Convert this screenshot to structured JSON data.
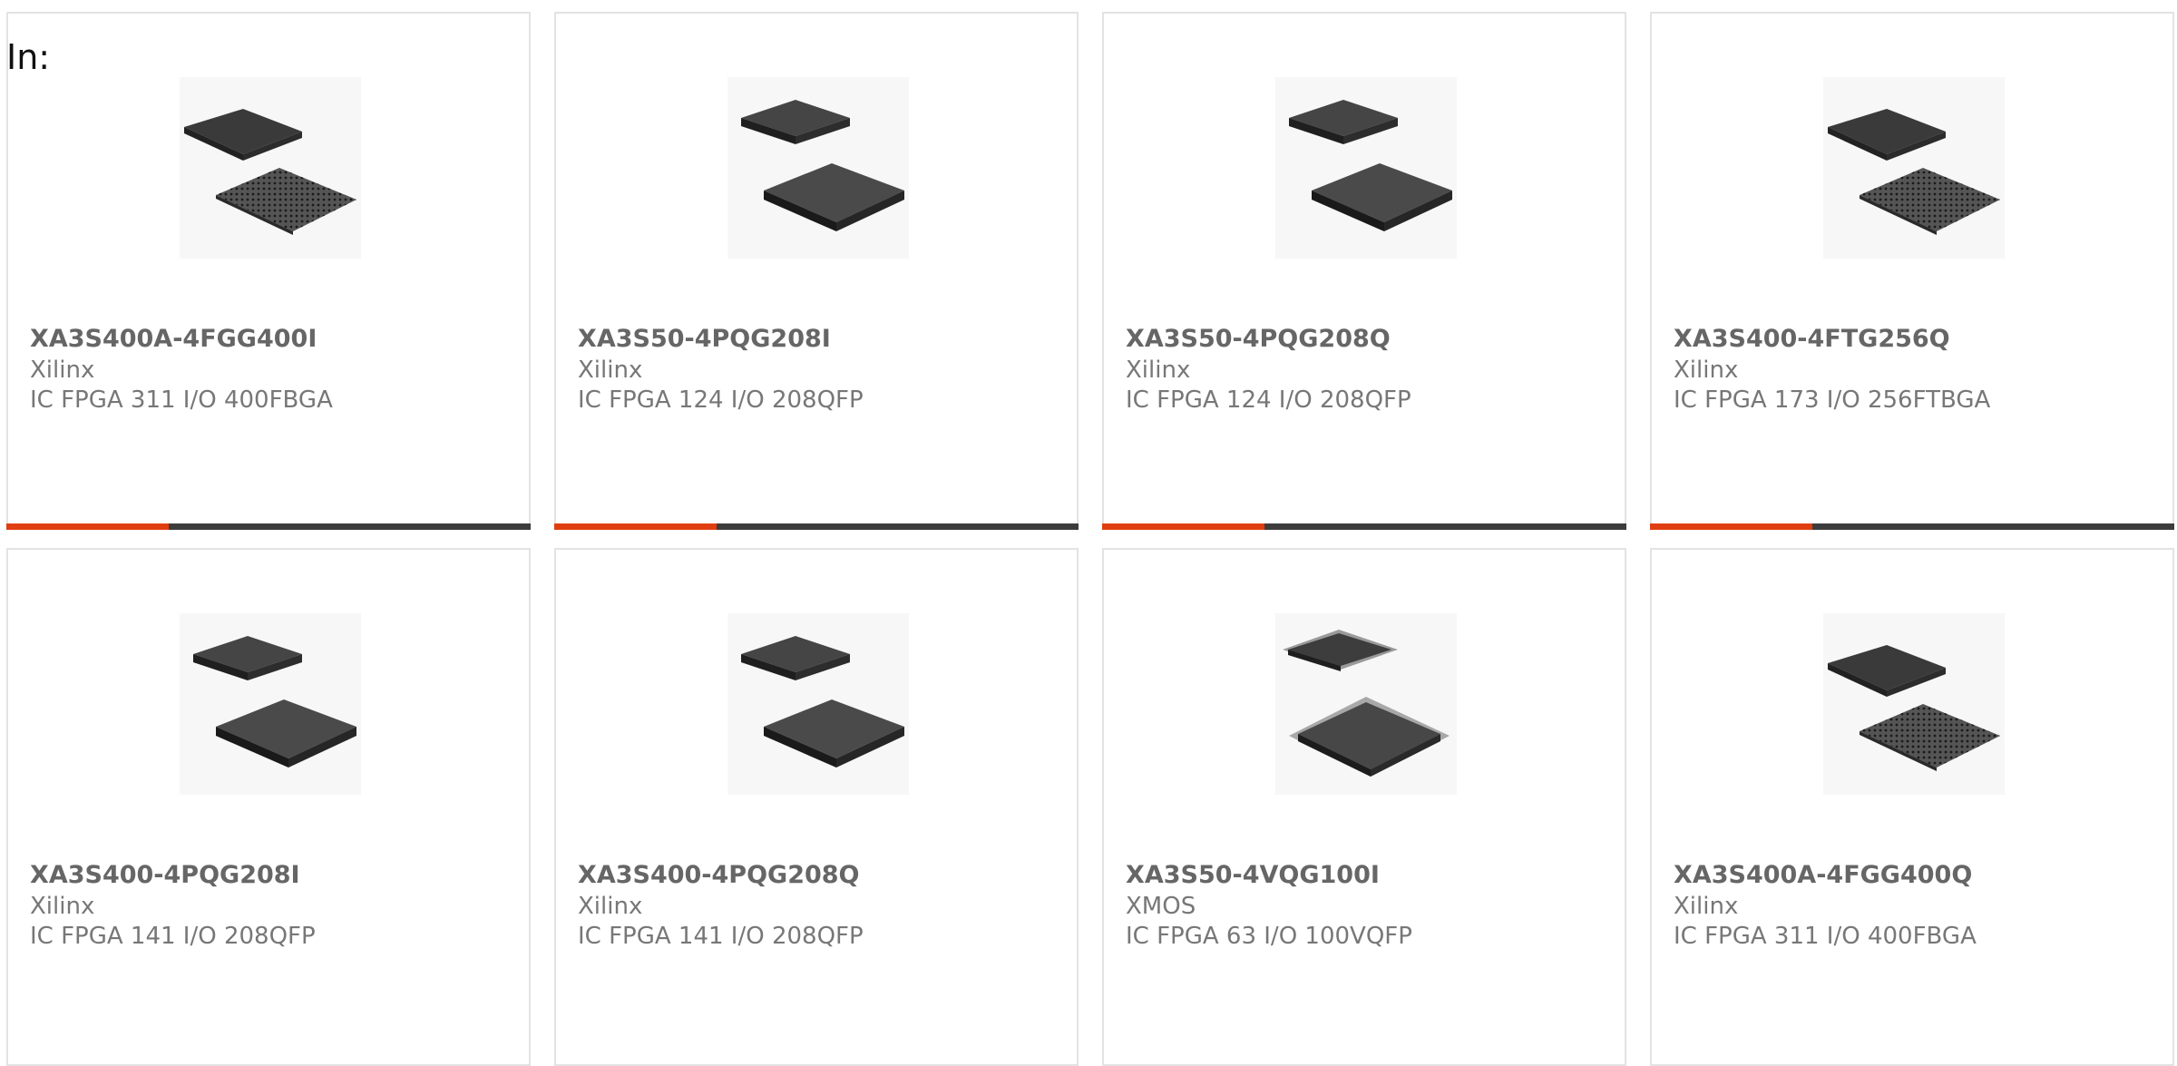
{
  "filter_label": "In:",
  "colors": {
    "accent": "#e03e10",
    "bar_track": "#3c3c3c",
    "card_border": "#e3e3e3",
    "text": "#777777"
  },
  "products": [
    {
      "part": "XA3S400A-4FGG400I",
      "manufacturer": "Xilinx",
      "description": "IC FPGA 311 I/O 400FBGA",
      "package_icon": "bga-package-icon",
      "progress": 0.31
    },
    {
      "part": "XA3S50-4PQG208I",
      "manufacturer": "Xilinx",
      "description": "IC FPGA 124 I/O 208QFP",
      "package_icon": "qfp-package-icon",
      "progress": 0.31
    },
    {
      "part": "XA3S50-4PQG208Q",
      "manufacturer": "Xilinx",
      "description": "IC FPGA 124 I/O 208QFP",
      "package_icon": "qfp-package-icon",
      "progress": 0.31
    },
    {
      "part": "XA3S400-4FTG256Q",
      "manufacturer": "Xilinx",
      "description": "IC FPGA 173 I/O 256FTBGA",
      "package_icon": "bga-package-icon",
      "progress": 0.31
    },
    {
      "part": "XA3S400-4PQG208I",
      "manufacturer": "Xilinx",
      "description": "IC FPGA 141 I/O 208QFP",
      "package_icon": "qfp-package-icon"
    },
    {
      "part": "XA3S400-4PQG208Q",
      "manufacturer": "Xilinx",
      "description": "IC FPGA 141 I/O 208QFP",
      "package_icon": "qfp-package-icon"
    },
    {
      "part": "XA3S50-4VQG100I",
      "manufacturer": "XMOS",
      "description": "IC FPGA 63 I/O 100VQFP",
      "package_icon": "vqfp-package-icon"
    },
    {
      "part": "XA3S400A-4FGG400Q",
      "manufacturer": "Xilinx",
      "description": "IC FPGA 311 I/O 400FBGA",
      "package_icon": "bga-package-icon"
    }
  ]
}
